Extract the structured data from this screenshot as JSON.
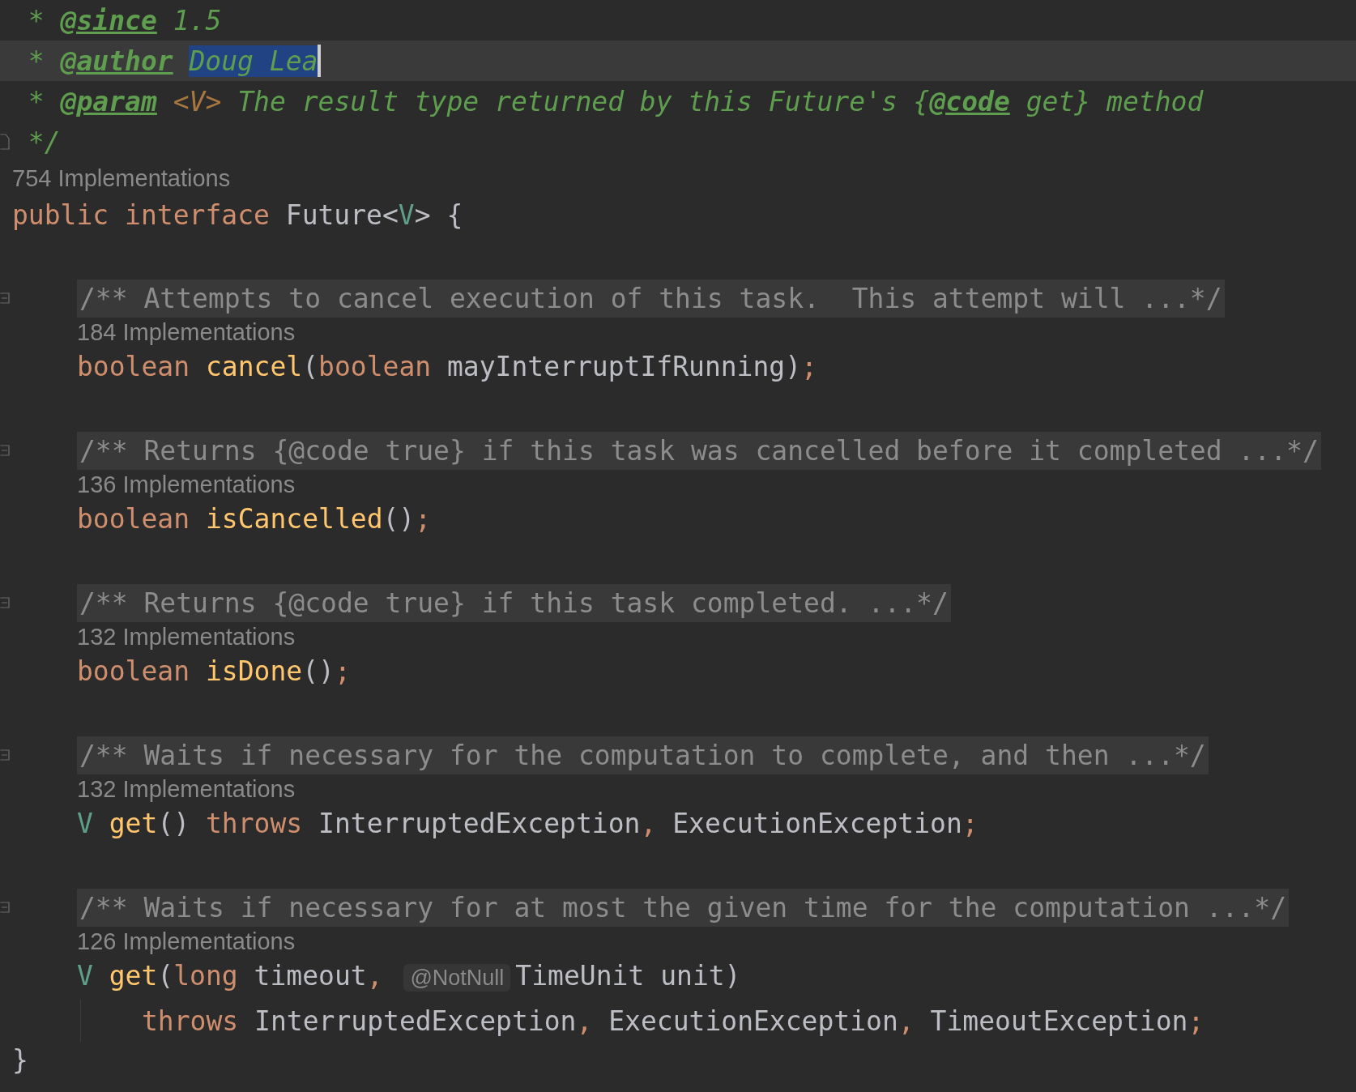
{
  "doc_comment": [
    {
      "current": false,
      "caret": false,
      "tokens": [
        {
          "text": " * ",
          "kind": "doc"
        },
        {
          "text": "@since",
          "kind": "tag"
        },
        {
          "text": " 1.5",
          "kind": "doc"
        }
      ]
    },
    {
      "current": true,
      "caret": true,
      "tokens": [
        {
          "text": " * ",
          "kind": "doc"
        },
        {
          "text": "@author",
          "kind": "tag"
        },
        {
          "text": "Doug Lea",
          "kind": "selection"
        }
      ]
    },
    {
      "current": false,
      "caret": false,
      "tokens": [
        {
          "text": " * ",
          "kind": "doc"
        },
        {
          "text": "@param",
          "kind": "tag"
        },
        {
          "text": " <V>",
          "kind": "doctype"
        },
        {
          "text": " The result type returned by this Future's {",
          "kind": "doc"
        },
        {
          "text": "@code",
          "kind": "tag"
        },
        {
          "text": " get} method",
          "kind": "doc"
        }
      ]
    },
    {
      "current": false,
      "caret": false,
      "tokens": [
        {
          "text": " */",
          "kind": "doc"
        }
      ]
    }
  ],
  "interface": {
    "hint": "754 Implementations",
    "declaration": [
      {
        "text": "public interface ",
        "kind": "keyword"
      },
      {
        "text": "Future<",
        "kind": "plain"
      },
      {
        "text": "V",
        "kind": "typevar"
      },
      {
        "text": "> {",
        "kind": "plain"
      }
    ],
    "members": [
      {
        "folded_doc": "/** Attempts to cancel execution of this task.  This attempt will ...*/",
        "hint": "184 Implementations",
        "lines": [
          {
            "tokens": [
              {
                "text": "boolean ",
                "kind": "keyword"
              },
              {
                "text": "cancel",
                "kind": "method"
              },
              {
                "text": "(",
                "kind": "plain"
              },
              {
                "text": "boolean ",
                "kind": "keyword"
              },
              {
                "text": "mayInterruptIfRunning)",
                "kind": "plain"
              },
              {
                "text": ";",
                "kind": "keyword"
              }
            ]
          }
        ]
      },
      {
        "folded_doc": "/** Returns {@code true} if this task was cancelled before it completed ...*/",
        "hint": "136 Implementations",
        "lines": [
          {
            "tokens": [
              {
                "text": "boolean ",
                "kind": "keyword"
              },
              {
                "text": "isCancelled",
                "kind": "method"
              },
              {
                "text": "()",
                "kind": "plain"
              },
              {
                "text": ";",
                "kind": "keyword"
              }
            ]
          }
        ]
      },
      {
        "folded_doc": "/** Returns {@code true} if this task completed. ...*/",
        "hint": "132 Implementations",
        "lines": [
          {
            "tokens": [
              {
                "text": "boolean ",
                "kind": "keyword"
              },
              {
                "text": "isDone",
                "kind": "method"
              },
              {
                "text": "()",
                "kind": "plain"
              },
              {
                "text": ";",
                "kind": "keyword"
              }
            ]
          }
        ]
      },
      {
        "folded_doc": "/** Waits if necessary for the computation to complete, and then ...*/",
        "hint": "132 Implementations",
        "lines": [
          {
            "tokens": [
              {
                "text": "V ",
                "kind": "typevar"
              },
              {
                "text": "get",
                "kind": "method"
              },
              {
                "text": "() ",
                "kind": "plain"
              },
              {
                "text": "throws ",
                "kind": "keyword"
              },
              {
                "text": "InterruptedException",
                "kind": "plain"
              },
              {
                "text": ", ",
                "kind": "keyword"
              },
              {
                "text": "ExecutionException",
                "kind": "plain"
              },
              {
                "text": ";",
                "kind": "keyword"
              }
            ]
          }
        ]
      },
      {
        "folded_doc": "/** Waits if necessary for at most the given time for the computation ...*/",
        "hint": "126 Implementations",
        "lines": [
          {
            "tokens": [
              {
                "text": "V ",
                "kind": "typevar"
              },
              {
                "text": "get",
                "kind": "method"
              },
              {
                "text": "(",
                "kind": "plain"
              },
              {
                "text": "long ",
                "kind": "keyword"
              },
              {
                "text": "timeout",
                "kind": "plain"
              },
              {
                "text": ", ",
                "kind": "keyword"
              },
              {
                "text": "@NotNull",
                "kind": "inlay"
              },
              {
                "text": "TimeUnit unit)",
                "kind": "plain"
              }
            ],
            "children": [
              {
                "tokens": [
                  {
                    "text": "throws ",
                    "kind": "keyword"
                  },
                  {
                    "text": "InterruptedException",
                    "kind": "plain"
                  },
                  {
                    "text": ", ",
                    "kind": "keyword"
                  },
                  {
                    "text": "ExecutionException",
                    "kind": "plain"
                  },
                  {
                    "text": ", ",
                    "kind": "keyword"
                  },
                  {
                    "text": "TimeoutException",
                    "kind": "plain"
                  },
                  {
                    "text": ";",
                    "kind": "keyword"
                  }
                ]
              }
            ]
          }
        ]
      }
    ],
    "closing": "}"
  }
}
